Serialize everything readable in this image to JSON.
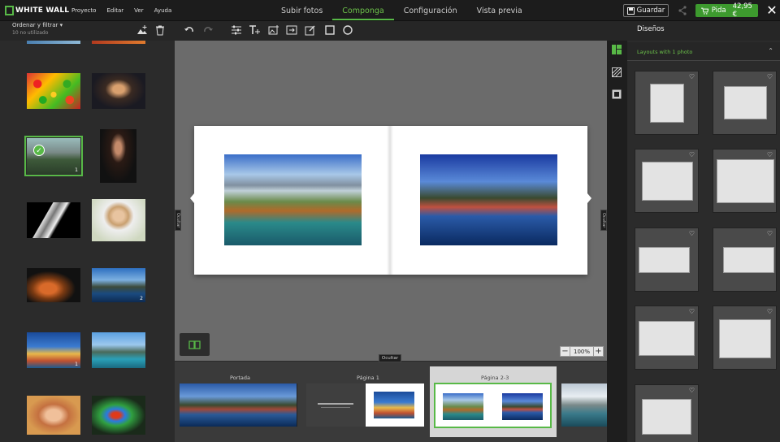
{
  "app": {
    "logo": "WHITE WALL",
    "menu": [
      "Proyecto",
      "Editar",
      "Ver",
      "Ayuda"
    ]
  },
  "steps": [
    {
      "label": "Subir fotos",
      "active": false
    },
    {
      "label": "Componga",
      "active": true
    },
    {
      "label": "Configuración",
      "active": false
    },
    {
      "label": "Vista previa",
      "active": false
    }
  ],
  "actions": {
    "save": "Guardar",
    "order": "Pida",
    "price": "42,95 €"
  },
  "left": {
    "sort_label": "Ordenar y filtrar",
    "unused": "10 no utilizado",
    "counts": {
      "forest": "1",
      "lofoten": "2",
      "cinque": "1"
    }
  },
  "right": {
    "title": "Diseños",
    "layouts_header": "Layouts with 1 photo"
  },
  "workspace": {
    "hide_left": "Ocultar",
    "hide_right": "Ocultar",
    "hide_bottom": "Ocultar",
    "zoom": "100%"
  },
  "pages": {
    "cover": "Portada",
    "page1": "Página 1",
    "page23": "Página 2-3"
  },
  "colors": {
    "accent": "#58b947",
    "order": "#3d9a2e",
    "bg": "#2b2b2b",
    "workspace": "#6b6b6b"
  },
  "icons": [
    "square-logo-icon",
    "undo-icon",
    "redo-icon",
    "adjust-icon",
    "text-icon",
    "add-image-icon",
    "replace-icon",
    "edit-icon",
    "square-icon",
    "circle-icon",
    "add-photo-icon",
    "trash-icon",
    "book-icon",
    "heart-icon",
    "share-icon",
    "close-icon",
    "save-icon",
    "cart-icon",
    "layouts-icon",
    "texture-icon",
    "frame-icon"
  ]
}
